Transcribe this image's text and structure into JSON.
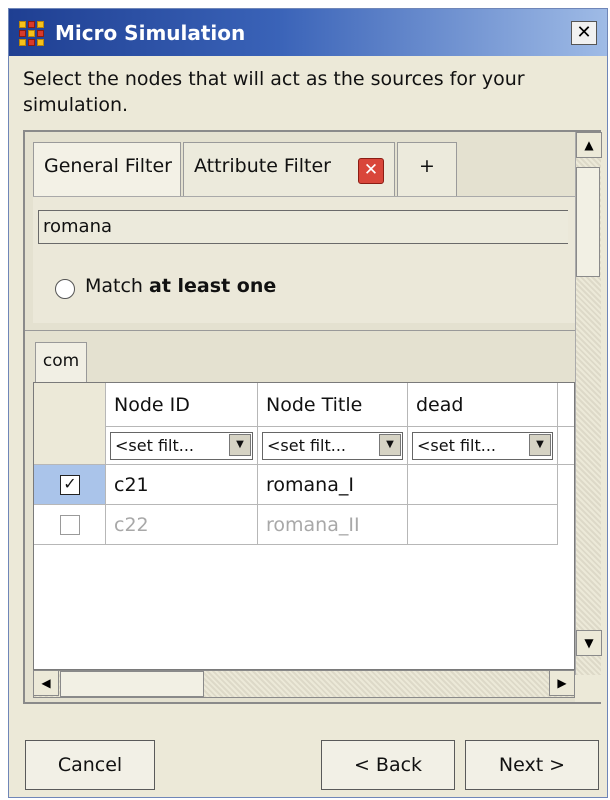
{
  "window": {
    "title": "Micro Simulation",
    "close_label": "✕",
    "app_icon": "grid-app-icon"
  },
  "instruction": "Select the nodes that will act as the sources for your simulation.",
  "tabs": [
    {
      "label": "General Filter",
      "active": true
    },
    {
      "label": "Attribute Filter",
      "active": false,
      "close_icon": "close-tab-icon"
    },
    {
      "label": "+",
      "active": false
    }
  ],
  "filter": {
    "search_value": "romana",
    "radio_label_prefix": "Match ",
    "radio_label_bold": "at least one"
  },
  "subtabs": [
    {
      "label": "com"
    }
  ],
  "table": {
    "columns": [
      "Node ID",
      "Node Title",
      "dead"
    ],
    "filter_placeholder": "<set filt...",
    "rows": [
      {
        "checked": true,
        "node_id": "c21",
        "node_title": "romana_I",
        "dead": "",
        "enabled": true
      },
      {
        "checked": false,
        "node_id": "c22",
        "node_title": "romana_II",
        "dead": "",
        "enabled": false
      }
    ]
  },
  "buttons": {
    "cancel": "Cancel",
    "back": "< Back",
    "next": "Next >"
  }
}
